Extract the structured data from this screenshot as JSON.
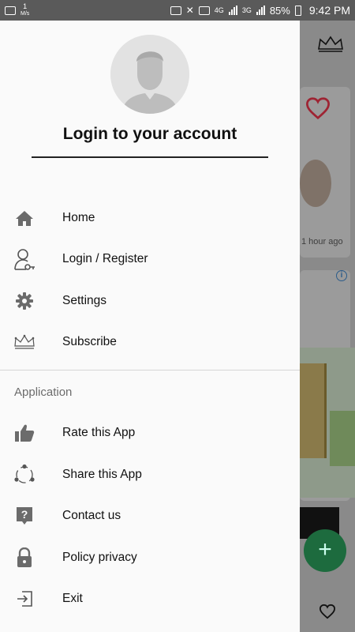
{
  "status_bar": {
    "notif_count": "1",
    "notif_unit": "M/s",
    "network_4g": "4G",
    "network_3g": "3G",
    "battery": "85%",
    "time": "9:42 PM"
  },
  "drawer": {
    "login_title": "Login to your account",
    "items": [
      {
        "label": "Home",
        "icon": "home-icon"
      },
      {
        "label": "Login / Register",
        "icon": "user-key-icon"
      },
      {
        "label": "Settings",
        "icon": "gear-icon"
      },
      {
        "label": "Subscribe",
        "icon": "crown-icon"
      }
    ],
    "section_label": "Application",
    "app_items": [
      {
        "label": "Rate this App",
        "icon": "thumbs-up-icon"
      },
      {
        "label": "Share this App",
        "icon": "share-icon"
      },
      {
        "label": "Contact us",
        "icon": "help-icon"
      },
      {
        "label": "Policy privacy",
        "icon": "lock-icon"
      },
      {
        "label": "Exit",
        "icon": "exit-icon"
      }
    ]
  },
  "background": {
    "post_time": "1 hour ago",
    "fab_symbol": "+",
    "info_symbol": "i"
  },
  "colors": {
    "drawer_bg": "#fafafa",
    "icon_grey": "#6b6b6b",
    "heart_red": "#b32a3a",
    "fab_green": "#1d6b3e"
  }
}
